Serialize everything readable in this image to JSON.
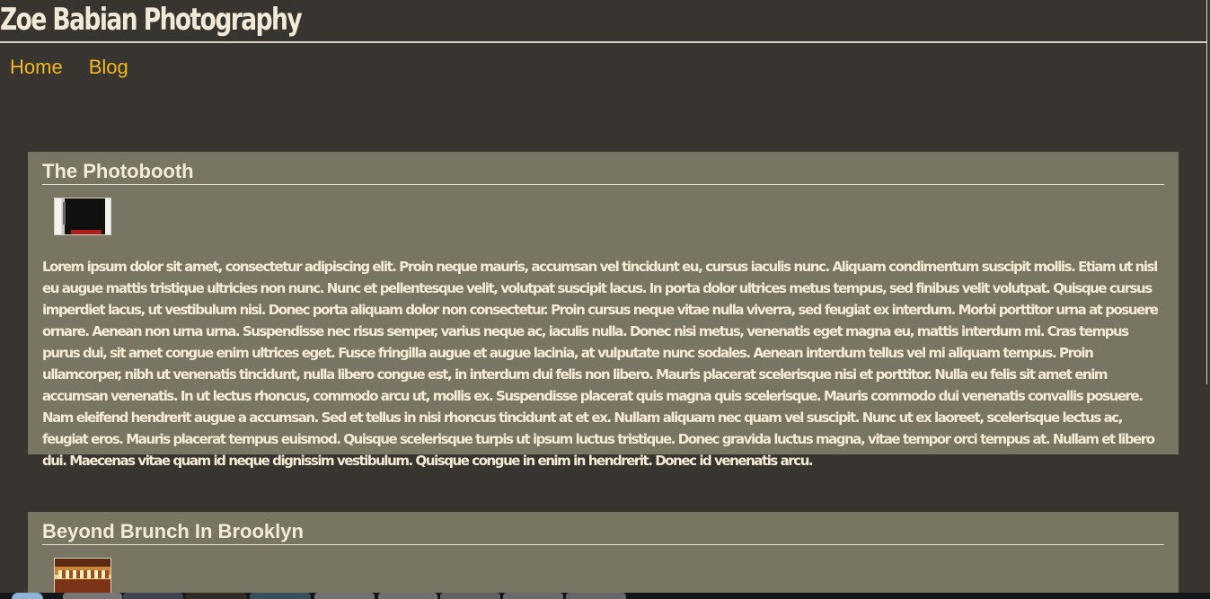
{
  "site": {
    "title": "Zoe Babian Photography"
  },
  "nav": {
    "items": [
      {
        "label": "Home"
      },
      {
        "label": "Blog"
      }
    ]
  },
  "posts": [
    {
      "title": "The Photobooth",
      "thumbnail_icon": "photobooth-thumbnail",
      "body": "Lorem ipsum dolor sit amet, consectetur adipiscing elit. Proin neque mauris, accumsan vel tincidunt eu, cursus iaculis nunc. Aliquam condimentum suscipit mollis. Etiam ut nisl eu augue mattis tristique ultricies non nunc. Nunc et pellentesque velit, volutpat suscipit lacus. In porta dolor ultrices metus tempus, sed finibus velit volutpat. Quisque cursus imperdiet lacus, ut vestibulum nisi. Donec porta aliquam dolor non consectetur. Proin cursus neque vitae nulla viverra, sed feugiat ex interdum. Morbi porttitor urna at posuere ornare. Aenean non urna urna. Suspendisse nec risus semper, varius neque ac, iaculis nulla. Donec nisi metus, venenatis eget magna eu, mattis interdum mi. Cras tempus purus dui, sit amet congue enim ultrices eget. Fusce fringilla augue et augue lacinia, at vulputate nunc sodales. Aenean interdum tellus vel mi aliquam tempus. Proin ullamcorper, nibh ut venenatis tincidunt, nulla libero congue est, in interdum dui felis non libero. Mauris placerat scelerisque nisi et porttitor. Nulla eu felis sit amet enim accumsan venenatis. In ut lectus rhoncus, commodo arcu ut, mollis ex. Suspendisse placerat quis magna quis scelerisque. Mauris commodo dui venenatis convallis posuere. Nam eleifend hendrerit augue a accumsan. Sed et tellus in nisi rhoncus tincidunt at et ex. Nullam aliquam nec quam vel suscipit. Nunc ut ex laoreet, scelerisque lectus ac, feugiat eros. Mauris placerat tempus euismod. Quisque scelerisque turpis ut ipsum luctus tristique. Donec gravida luctus magna, vitae tempor orci tempus at. Nullam et libero dui. Maecenas vitae quam id neque dignissim vestibulum. Quisque congue in enim in hendrerit. Donec id venenatis arcu."
    },
    {
      "title": "Beyond Brunch In Brooklyn",
      "thumbnail_icon": "brunch-thumbnail"
    }
  ],
  "colors": {
    "background": "#383530",
    "post_background": "#797563",
    "header_text": "#f2ead6",
    "nav_link": "#f0b71f",
    "post_text": "#f4ead4"
  }
}
